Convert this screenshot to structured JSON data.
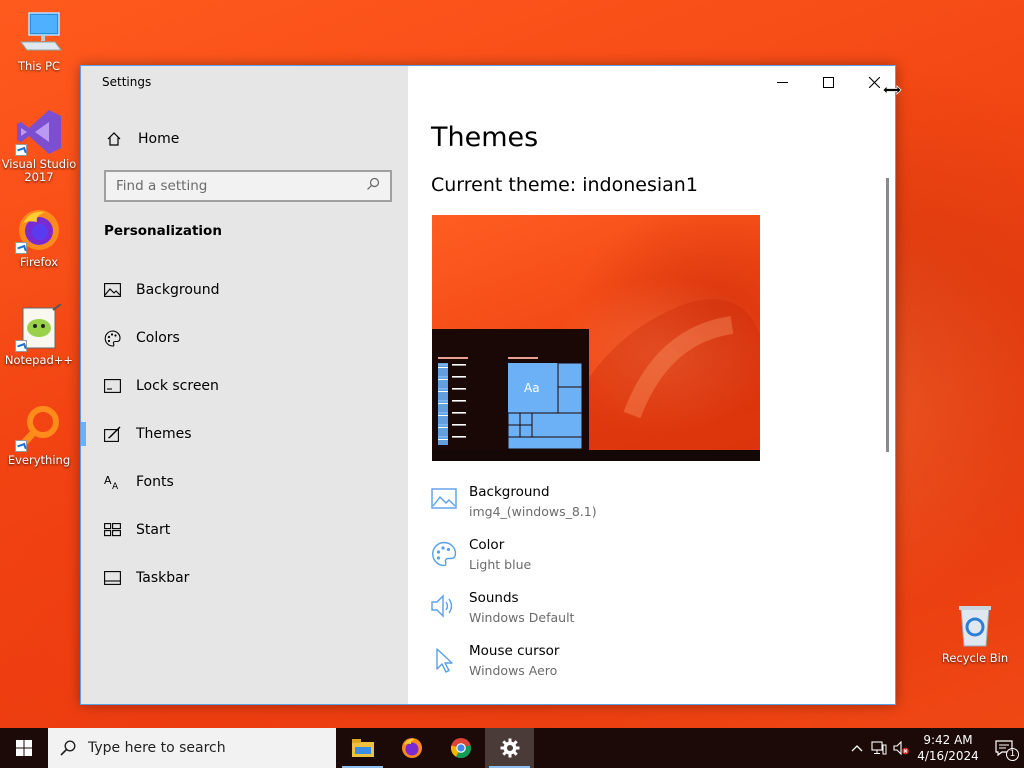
{
  "desktop": {
    "icons": [
      {
        "label": "This PC"
      },
      {
        "label": "Visual Studio 2017"
      },
      {
        "label": "Firefox"
      },
      {
        "label": "Notepad++"
      },
      {
        "label": "Everything"
      },
      {
        "label": "Recycle Bin"
      }
    ]
  },
  "window": {
    "app_title": "Settings",
    "nav": {
      "home": "Home",
      "search_placeholder": "Find a setting",
      "section": "Personalization",
      "items": [
        {
          "label": "Background",
          "icon": "picture-icon"
        },
        {
          "label": "Colors",
          "icon": "palette-icon"
        },
        {
          "label": "Lock screen",
          "icon": "lock-screen-icon"
        },
        {
          "label": "Themes",
          "icon": "themes-icon",
          "active": true
        },
        {
          "label": "Fonts",
          "icon": "fonts-icon"
        },
        {
          "label": "Start",
          "icon": "start-icon"
        },
        {
          "label": "Taskbar",
          "icon": "taskbar-icon"
        }
      ]
    },
    "main": {
      "title": "Themes",
      "current_theme": "Current theme: indonesian1",
      "preview_tile_text": "Aa",
      "settings": [
        {
          "title": "Background",
          "value": "img4_(windows_8.1)",
          "icon": "picture-icon"
        },
        {
          "title": "Color",
          "value": "Light blue",
          "icon": "palette-icon"
        },
        {
          "title": "Sounds",
          "value": "Windows Default",
          "icon": "speaker-icon"
        },
        {
          "title": "Mouse cursor",
          "value": "Windows Aero",
          "icon": "cursor-icon"
        }
      ]
    }
  },
  "taskbar": {
    "search_placeholder": "Type here to search",
    "time": "9:42 AM",
    "date": "4/16/2024",
    "notification_count": "1"
  },
  "colors": {
    "accent": "#6cb0f5",
    "taskbar": "#1c0a08",
    "wallpaper": "#f24512"
  }
}
